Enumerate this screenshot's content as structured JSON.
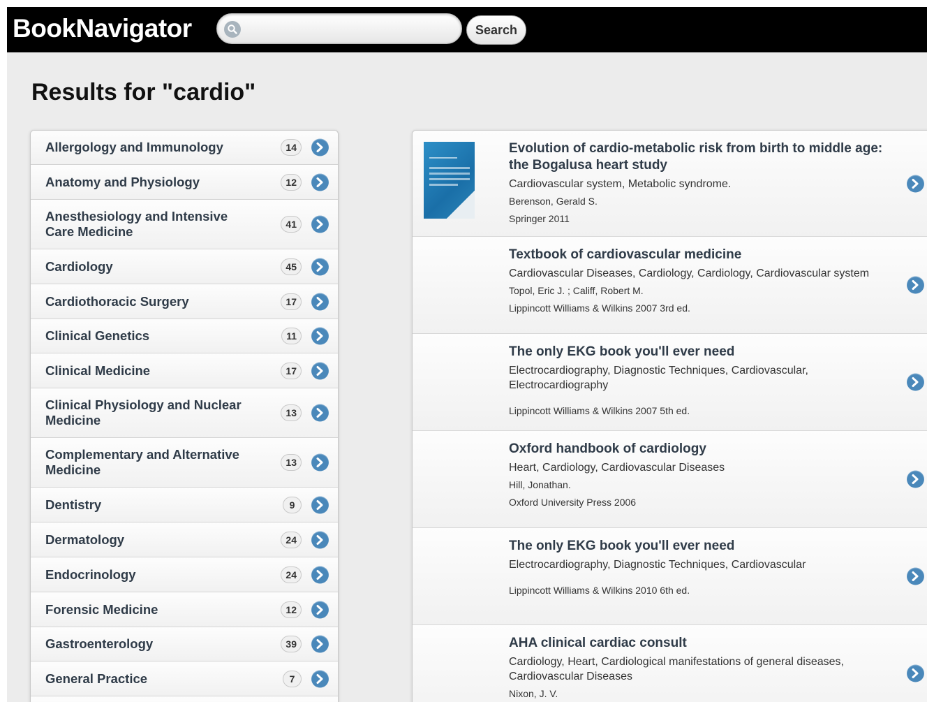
{
  "header": {
    "logo": "BookNavigator",
    "search_placeholder": "",
    "search_value": "",
    "search_button": "Search"
  },
  "results_title": "Results for \"cardio\"",
  "categories": [
    {
      "label": "Allergology and Immunology",
      "count": "14"
    },
    {
      "label": "Anatomy and Physiology",
      "count": "12"
    },
    {
      "label": "Anesthesiology and Intensive Care Medicine",
      "count": "41"
    },
    {
      "label": "Cardiology",
      "count": "45"
    },
    {
      "label": "Cardiothoracic Surgery",
      "count": "17"
    },
    {
      "label": "Clinical Genetics",
      "count": "11"
    },
    {
      "label": "Clinical Medicine",
      "count": "17"
    },
    {
      "label": "Clinical Physiology and Nuclear Medicine",
      "count": "13"
    },
    {
      "label": "Complementary and Alternative Medicine",
      "count": "13"
    },
    {
      "label": "Dentistry",
      "count": "9"
    },
    {
      "label": "Dermatology",
      "count": "24"
    },
    {
      "label": "Endocrinology",
      "count": "24"
    },
    {
      "label": "Forensic Medicine",
      "count": "12"
    },
    {
      "label": "Gastroenterology",
      "count": "39"
    },
    {
      "label": "General Practice",
      "count": "7"
    },
    {
      "label": "",
      "count": ""
    }
  ],
  "books": [
    {
      "title": "Evolution of cardio-metabolic risk from birth to middle age: the Bogalusa heart study",
      "subjects": "Cardiovascular system, Metabolic syndrome.",
      "authors": "Berenson, Gerald S.",
      "publisher": "Springer  2011",
      "has_cover": true
    },
    {
      "title": "Textbook of cardiovascular medicine",
      "subjects": "Cardiovascular Diseases, Cardiology, Cardiology, Cardiovascular system",
      "authors": "Topol, Eric J. ; Califf, Robert M.",
      "publisher": "Lippincott Williams & Wilkins  2007  3rd ed.",
      "has_cover": false
    },
    {
      "title": "The only EKG book you'll ever need",
      "subjects": "Electrocardiography, Diagnostic Techniques, Cardiovascular, Electrocardiography",
      "authors": "",
      "publisher": "Lippincott Williams & Wilkins  2007  5th ed.",
      "has_cover": false
    },
    {
      "title": "Oxford handbook of cardiology",
      "subjects": "Heart, Cardiology, Cardiovascular Diseases",
      "authors": "Hill, Jonathan.",
      "publisher": "Oxford University Press  2006",
      "has_cover": false
    },
    {
      "title": "The only EKG book you'll ever need",
      "subjects": "Electrocardiography, Diagnostic Techniques, Cardiovascular",
      "authors": "",
      "publisher": "Lippincott Williams & Wilkins  2010  6th ed.",
      "has_cover": false
    },
    {
      "title": "AHA clinical cardiac consult",
      "subjects": "Cardiology, Heart, Cardiological manifestations of general diseases, Cardiovascular Diseases",
      "authors": "Nixon, J. V.",
      "publisher": "",
      "has_cover": false
    }
  ],
  "colors": {
    "header_bg": "#000000",
    "accent_arrow": "#4a88ba",
    "page_bg": "#ececec"
  },
  "icons": {
    "search": "search-icon",
    "row_arrow": "chevron-right-circle-icon"
  }
}
